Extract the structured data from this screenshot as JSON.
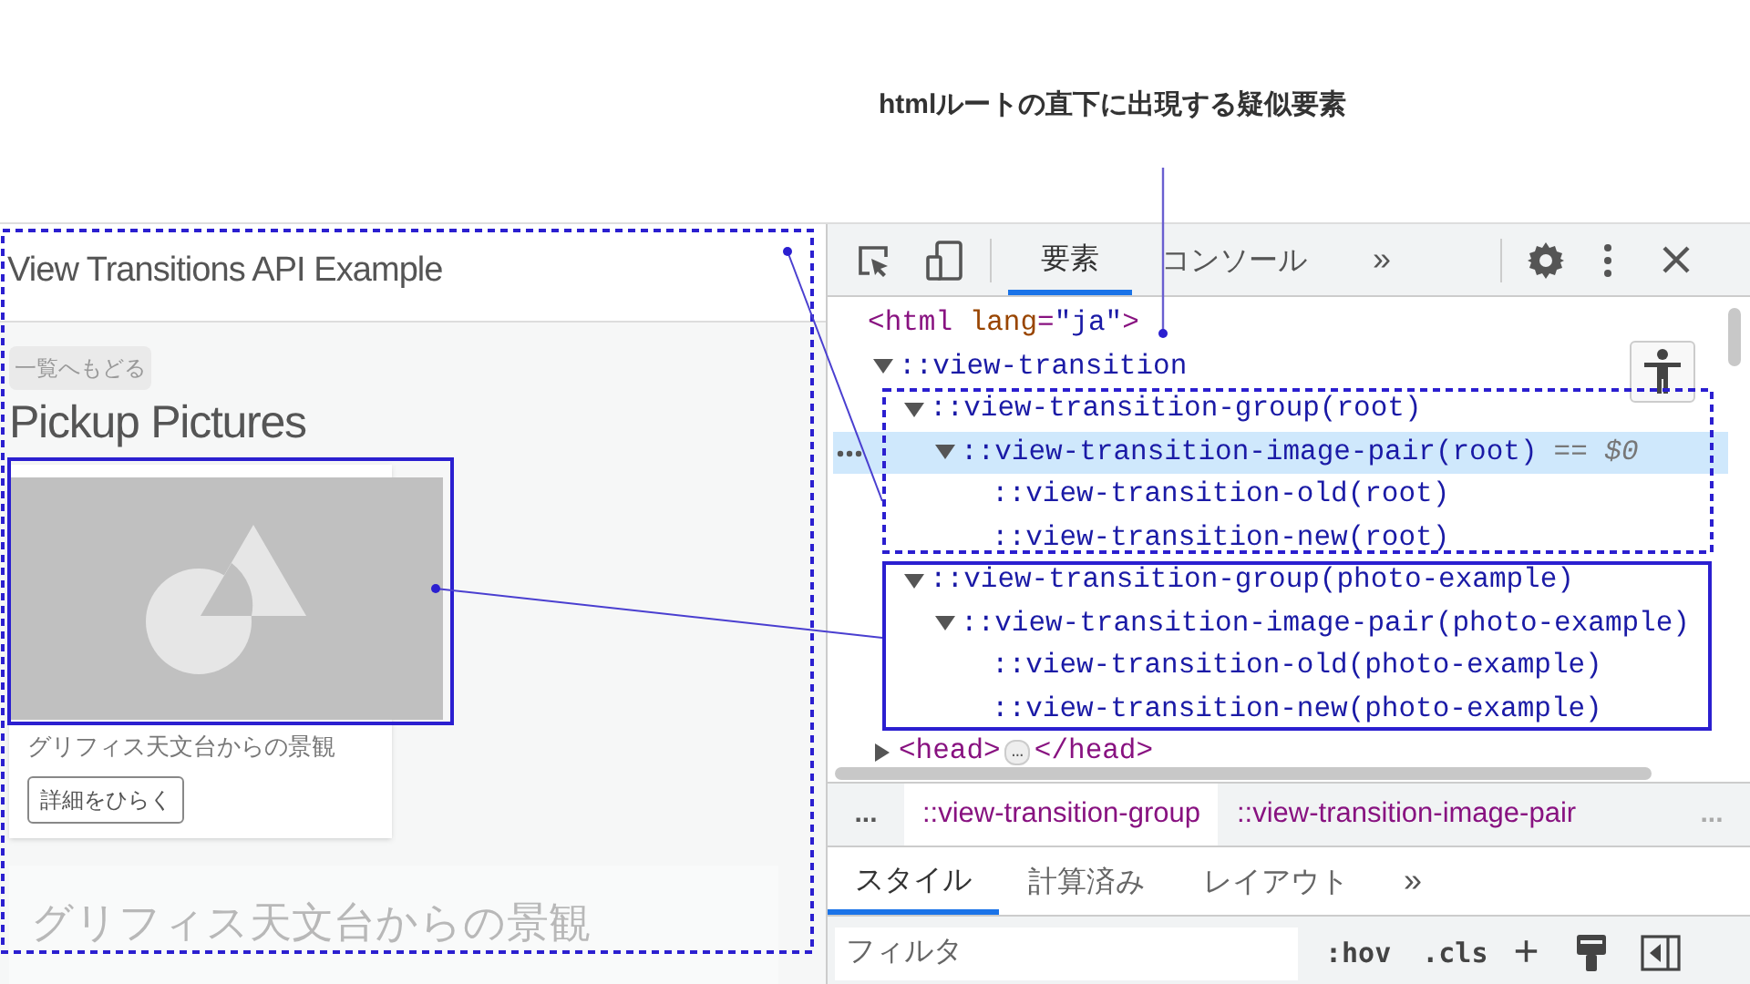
{
  "annotation": {
    "title": "htmlルートの直下に出現する疑似要素"
  },
  "page": {
    "title": "View Transitions API Example",
    "back_link": "一覧へもどる",
    "heading": "Pickup Pictures",
    "card": {
      "caption": "グリフィス天文台からの景観",
      "button": "詳細をひらく"
    },
    "next_card": {
      "title": "グリフィス天文台からの景観"
    }
  },
  "devtools": {
    "tabs": [
      {
        "label": "要素",
        "selected": true
      },
      {
        "label": "コンソール",
        "selected": false
      }
    ],
    "more_tabs": "»",
    "tree": [
      {
        "kind": "element",
        "open": "<",
        "tag": "html",
        "attr": "lang",
        "equals": "=",
        "value": "\"ja\"",
        "close": ">",
        "selected": false,
        "children": [
          {
            "kind": "pseudo",
            "text": "::view-transition",
            "expanded": true,
            "selected": false,
            "children": [
              {
                "kind": "pseudo",
                "text": "::view-transition-group(root)",
                "expanded": true,
                "selected": false,
                "children": [
                  {
                    "kind": "pseudo",
                    "text": "::view-transition-image-pair(root)",
                    "suffix": "== $0",
                    "expanded": true,
                    "selected": true,
                    "children": [
                      {
                        "kind": "pseudo",
                        "text": "::view-transition-old(root)",
                        "selected": false
                      },
                      {
                        "kind": "pseudo",
                        "text": "::view-transition-new(root)",
                        "selected": false
                      }
                    ]
                  }
                ]
              },
              {
                "kind": "pseudo",
                "text": "::view-transition-group(photo-example)",
                "expanded": true,
                "selected": false,
                "children": [
                  {
                    "kind": "pseudo",
                    "text": "::view-transition-image-pair(photo-example)",
                    "expanded": true,
                    "selected": false,
                    "children": [
                      {
                        "kind": "pseudo",
                        "text": "::view-transition-old(photo-example)",
                        "selected": false
                      },
                      {
                        "kind": "pseudo",
                        "text": "::view-transition-new(photo-example)",
                        "selected": false
                      }
                    ]
                  }
                ]
              }
            ]
          },
          {
            "kind": "collapsed",
            "open_tag": "<head>",
            "badge": "…",
            "close_tag": "</head>",
            "expanded": false,
            "selected": false
          }
        ]
      }
    ],
    "breadcrumbs": {
      "before": "...",
      "items": [
        {
          "label": "::view-transition-group",
          "selected": true
        },
        {
          "label": "::view-transition-image-pair",
          "selected": false
        }
      ],
      "after": "..."
    },
    "style_tabs": [
      {
        "label": "スタイル",
        "selected": true
      },
      {
        "label": "計算済み",
        "selected": false
      },
      {
        "label": "レイアウト",
        "selected": false
      }
    ],
    "more_style_tabs": "»",
    "filter": {
      "placeholder": "フィルタ"
    },
    "hov": ":hov",
    "cls": ".cls",
    "add": "+"
  }
}
